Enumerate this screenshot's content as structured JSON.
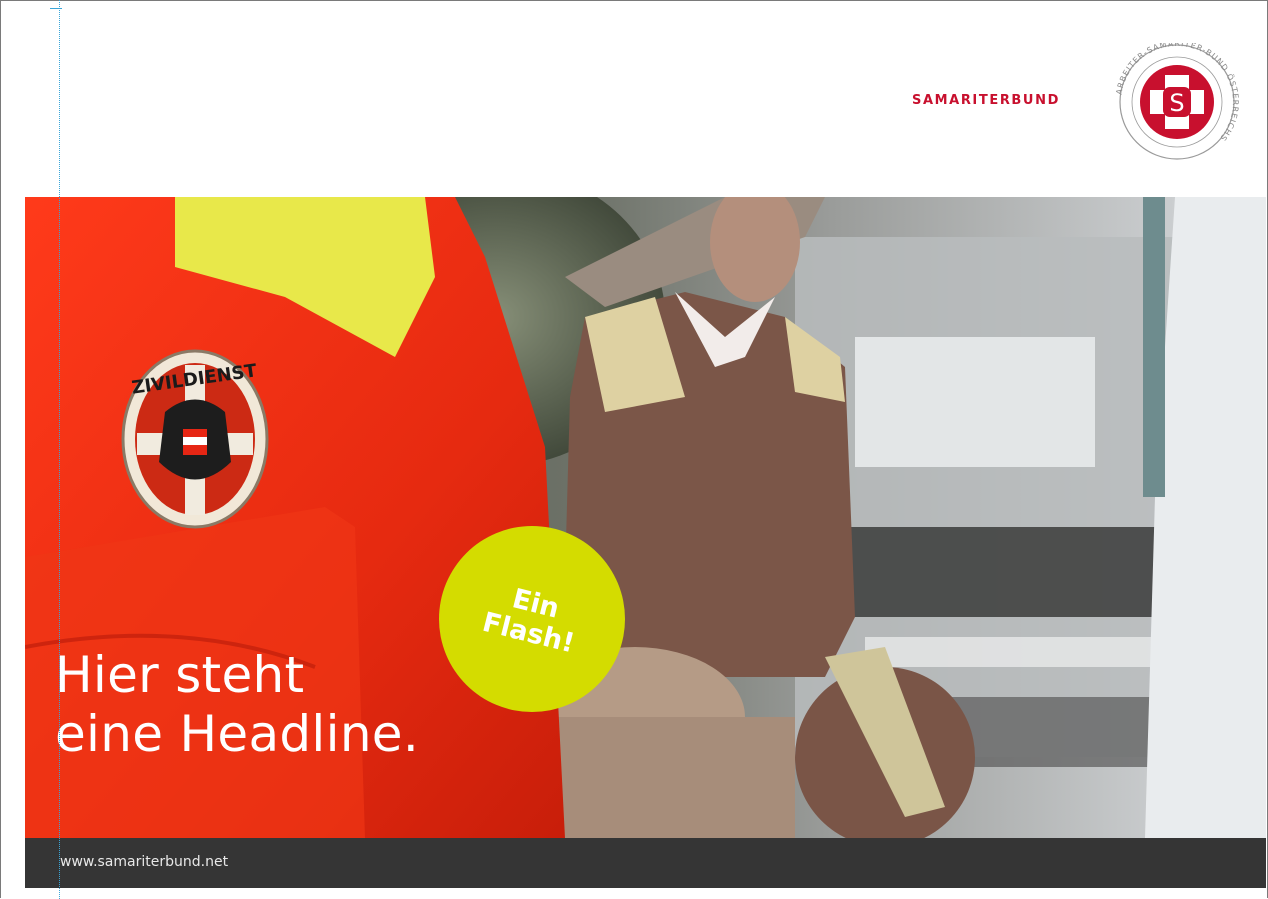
{
  "brand": {
    "wordmark": "SAMARITERBUND",
    "seal_ring_text": "ARBEITER-SAMARITER-BUND ÖSTERREICHS",
    "seal_letter": "S",
    "accent_color": "#c8102e"
  },
  "hero": {
    "patch_text": "ZIVILDIENST",
    "headline_line1": "Hier steht",
    "headline_line2": "eine Headline."
  },
  "flash": {
    "line1": "Ein",
    "line2": "Flash!",
    "color": "#d4dc00"
  },
  "footer": {
    "url": "www.samariterbund.net",
    "background": "#353535"
  }
}
